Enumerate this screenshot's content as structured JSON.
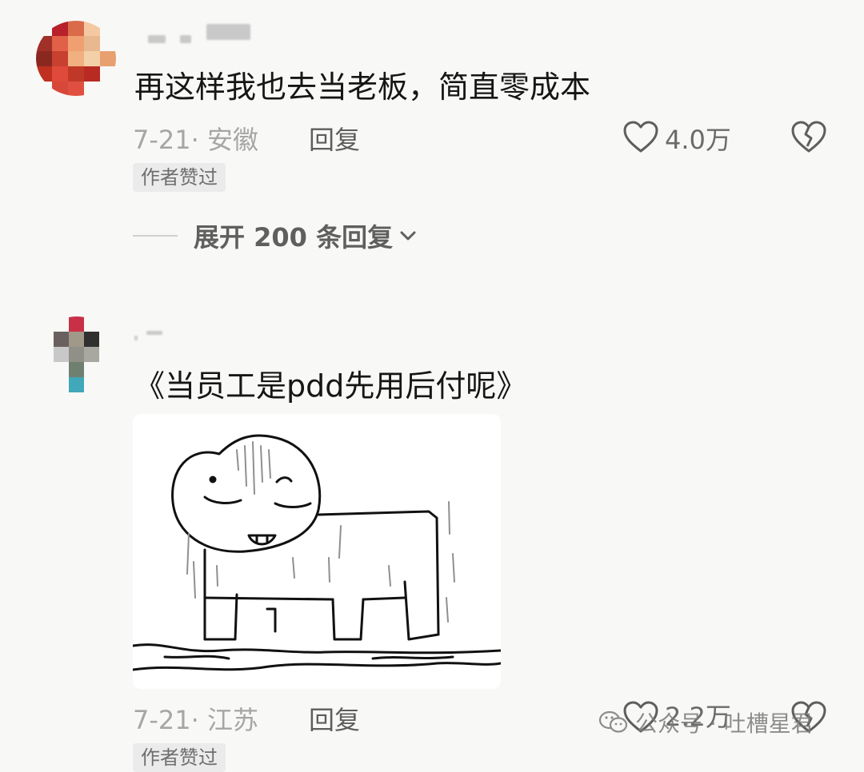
{
  "comments": [
    {
      "text": "再这样我也去当老板，简直零成本",
      "date_location": "7-21· 安徽",
      "reply_label": "回复",
      "likes": "4.0万",
      "badge": "作者赞过",
      "expand_replies": "展开 200 条回复"
    },
    {
      "text": "《当员工是pdd先用后付呢》",
      "date_location": "7-21· 江苏",
      "reply_label": "回复",
      "likes": "2.2万",
      "badge": "作者赞过"
    }
  ],
  "watermark": {
    "text": "公众号 · 吐槽星君",
    "icon": "wechat-icon"
  },
  "icons": {
    "like": "heart-outline-icon",
    "dislike": "broken-heart-icon",
    "expand": "chevron-down-icon"
  },
  "colors": {
    "background": "#f8f8f6",
    "text_primary": "#161616",
    "text_meta": "#a6a6a6",
    "badge_bg": "#ebebeb"
  }
}
